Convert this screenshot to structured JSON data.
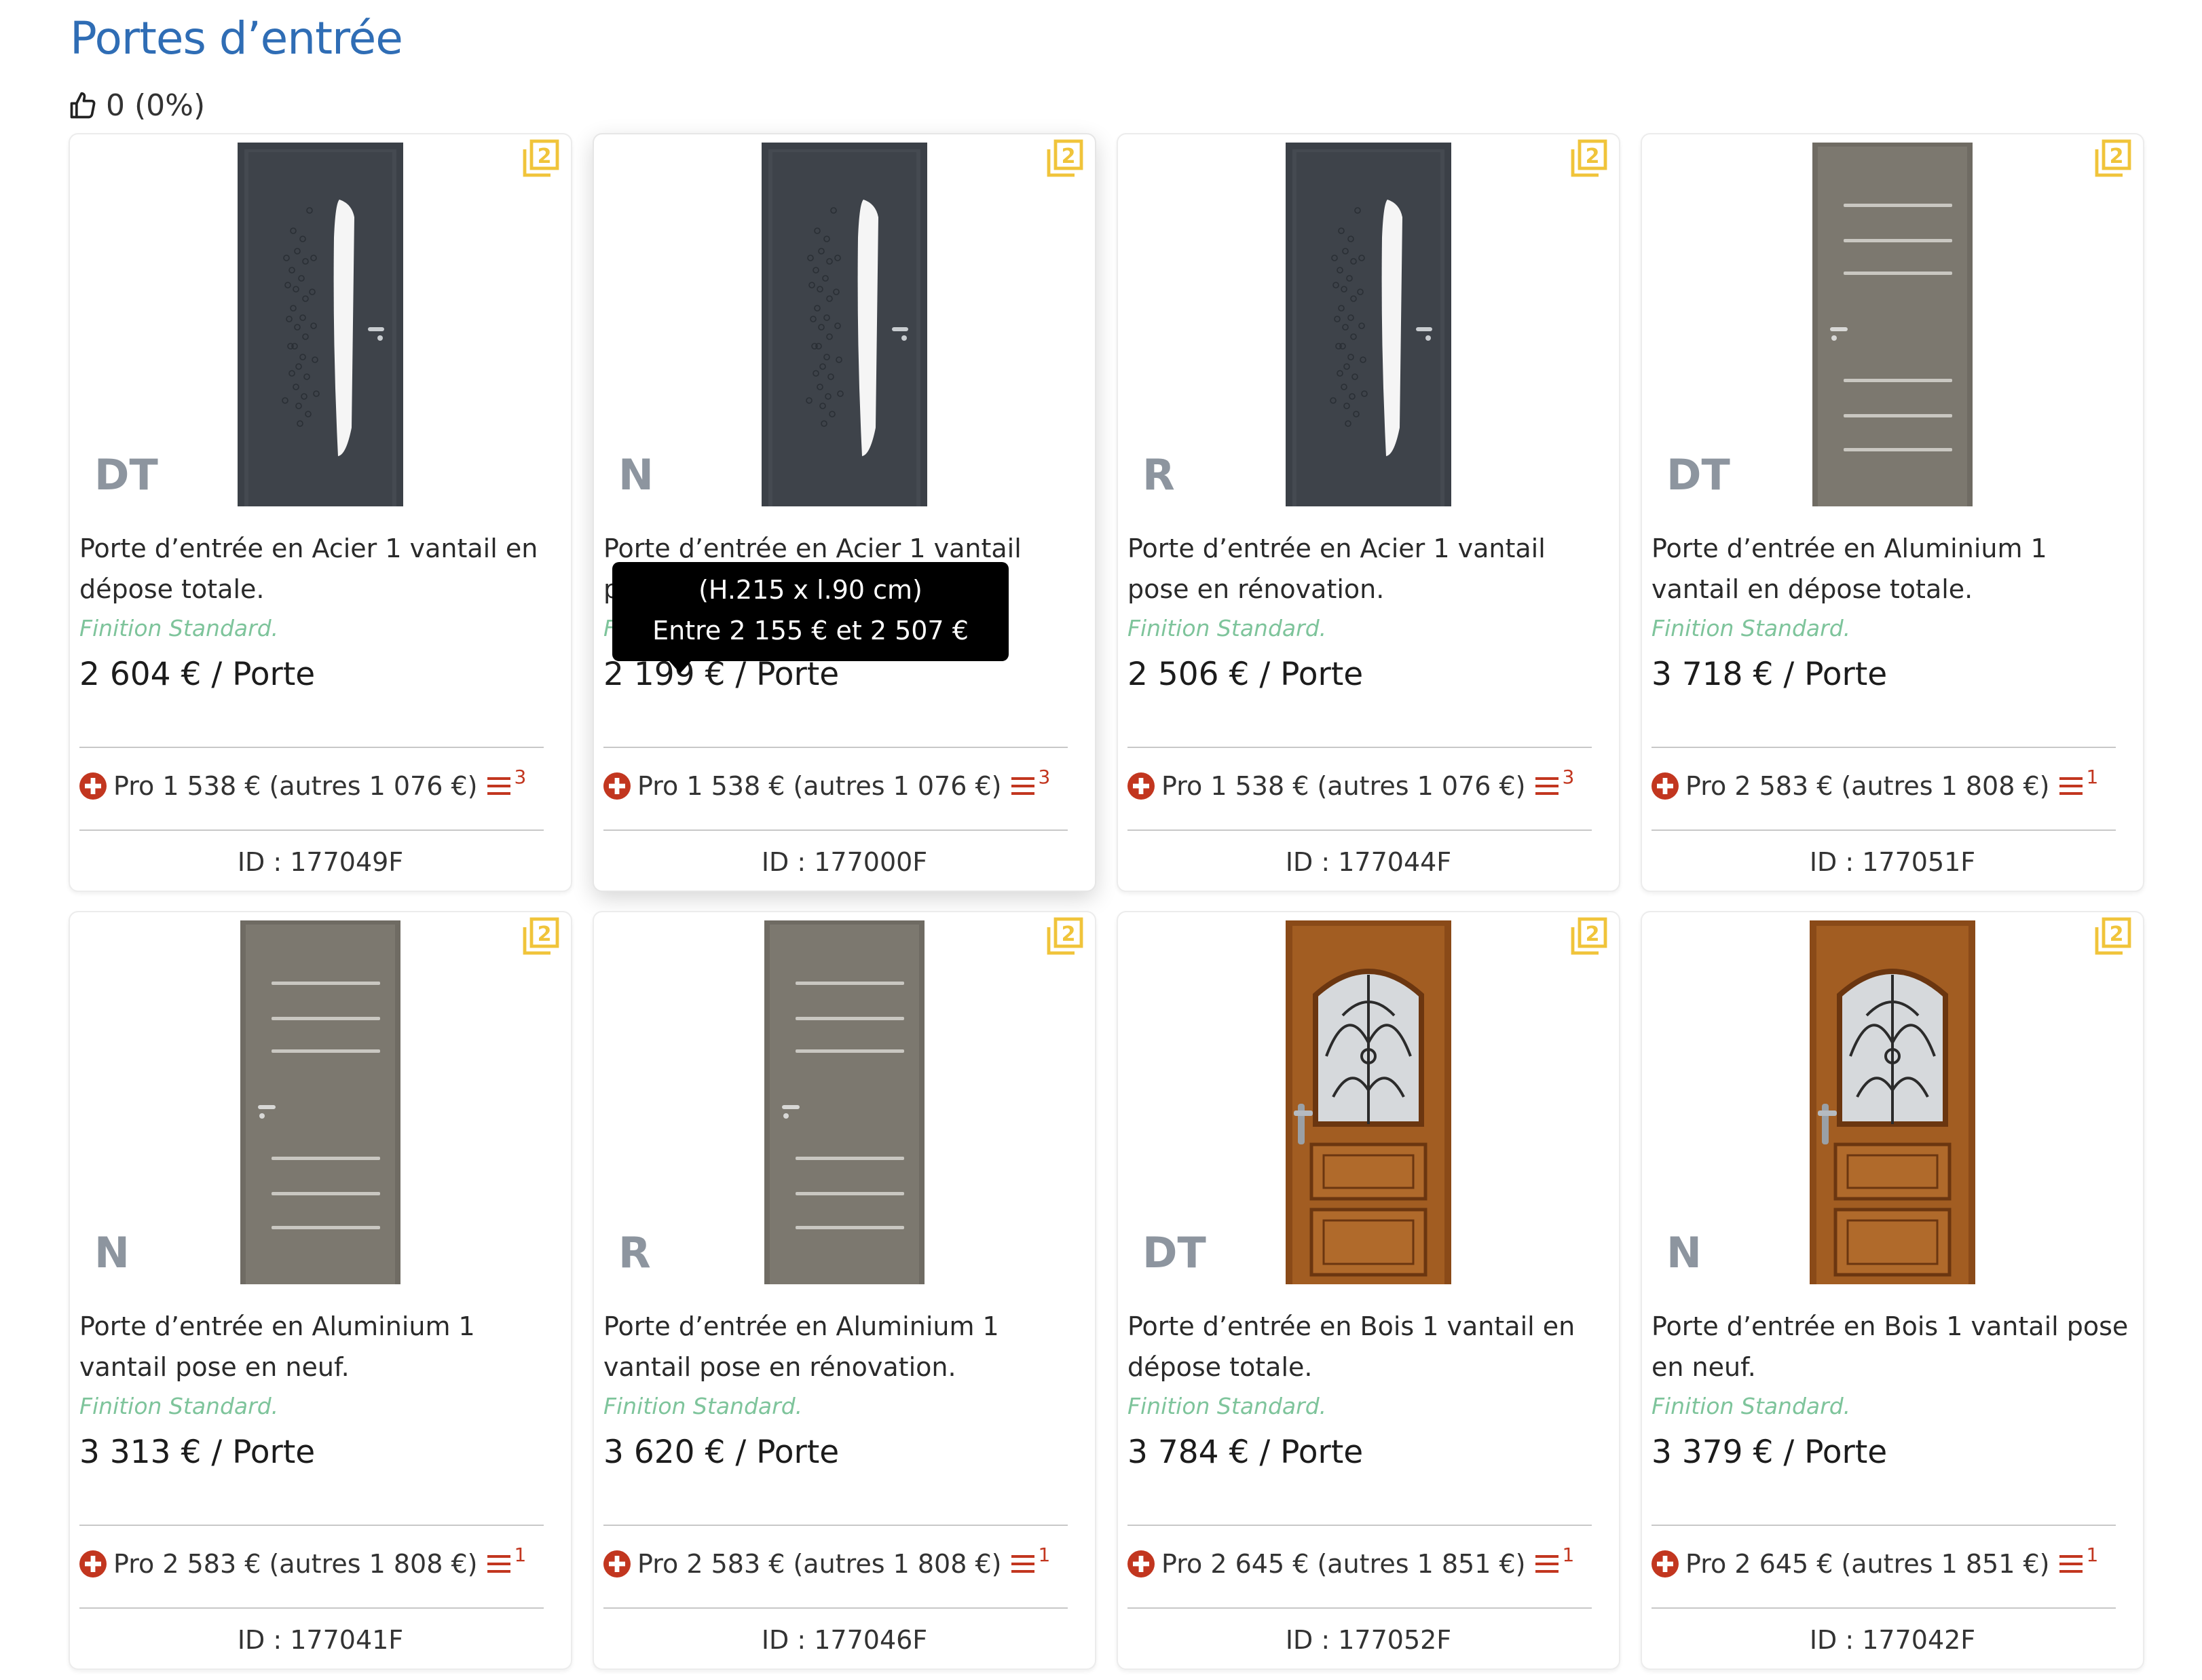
{
  "page": {
    "title": "Portes d’entrée"
  },
  "likes": {
    "text": "0 (0%)"
  },
  "colors": {
    "title": "#2f6db5",
    "finish": "#7ec49b",
    "badge": "#8d959f",
    "pro_icon": "#c2361f",
    "compare_icon": "#f0c43a"
  },
  "tooltip": {
    "line1": "(H.215 x l.90 cm)",
    "line2": "Entre 2 155 € et 2 507 €"
  },
  "products": [
    {
      "badge": "DT",
      "description": "Porte d’entrée en Acier 1 vantail en dépose totale.",
      "finish": "Finition Standard.",
      "price": "2 604 € / Porte",
      "pro": "Pro 1 538 € (autres 1 076 €)",
      "list_count": "3",
      "id": "ID : 177049F",
      "door": "steel",
      "icons": [
        "compare-icon",
        "plus-circle-icon",
        "list-icon"
      ]
    },
    {
      "badge": "N",
      "description": "Porte d’entrée en Acier 1 vantail pose en rénovation.",
      "finish": "Finition Standard.",
      "price": "2 199 € / Porte",
      "pro": "Pro 1 538 € (autres 1 076 €)",
      "list_count": "3",
      "id": "ID : 177000F",
      "door": "steel",
      "icons": [
        "compare-icon",
        "plus-circle-icon",
        "list-icon"
      ]
    },
    {
      "badge": "R",
      "description": "Porte d’entrée en Acier 1 vantail pose en rénovation.",
      "finish": "Finition Standard.",
      "price": "2 506 € / Porte",
      "pro": "Pro 1 538 € (autres 1 076 €)",
      "list_count": "3",
      "id": "ID : 177044F",
      "door": "steel",
      "icons": [
        "compare-icon",
        "plus-circle-icon",
        "list-icon"
      ]
    },
    {
      "badge": "DT",
      "description": "Porte d’entrée en Aluminium 1 vantail en dépose totale.",
      "finish": "Finition Standard.",
      "price": "3 718 € / Porte",
      "pro": "Pro 2 583 € (autres 1 808 €)",
      "list_count": "1",
      "id": "ID : 177051F",
      "door": "alu",
      "icons": [
        "compare-icon",
        "plus-circle-icon",
        "list-icon"
      ]
    },
    {
      "badge": "N",
      "description": "Porte d’entrée en Aluminium 1 vantail pose en neuf.",
      "finish": "Finition Standard.",
      "price": "3 313 € / Porte",
      "pro": "Pro 2 583 € (autres 1 808 €)",
      "list_count": "1",
      "id": "ID : 177041F",
      "door": "alu",
      "icons": [
        "compare-icon",
        "plus-circle-icon",
        "list-icon"
      ]
    },
    {
      "badge": "R",
      "description": "Porte d’entrée en Aluminium 1 vantail pose en rénovation.",
      "finish": "Finition Standard.",
      "price": "3 620 € / Porte",
      "pro": "Pro 2 583 € (autres 1 808 €)",
      "list_count": "1",
      "id": "ID : 177046F",
      "door": "alu",
      "icons": [
        "compare-icon",
        "plus-circle-icon",
        "list-icon"
      ]
    },
    {
      "badge": "DT",
      "description": "Porte d’entrée en Bois 1 vantail en dépose totale.",
      "finish": "Finition Standard.",
      "price": "3 784 € / Porte",
      "pro": "Pro 2 645 € (autres 1 851 €)",
      "list_count": "1",
      "id": "ID : 177052F",
      "door": "wood",
      "icons": [
        "compare-icon",
        "plus-circle-icon",
        "list-icon"
      ]
    },
    {
      "badge": "N",
      "description": "Porte d’entrée en Bois 1 vantail pose en neuf.",
      "finish": "Finition Standard.",
      "price": "3 379 € / Porte",
      "pro": "Pro 2 645 € (autres 1 851 €)",
      "list_count": "1",
      "id": "ID : 177042F",
      "door": "wood",
      "icons": [
        "compare-icon",
        "plus-circle-icon",
        "list-icon"
      ]
    }
  ]
}
